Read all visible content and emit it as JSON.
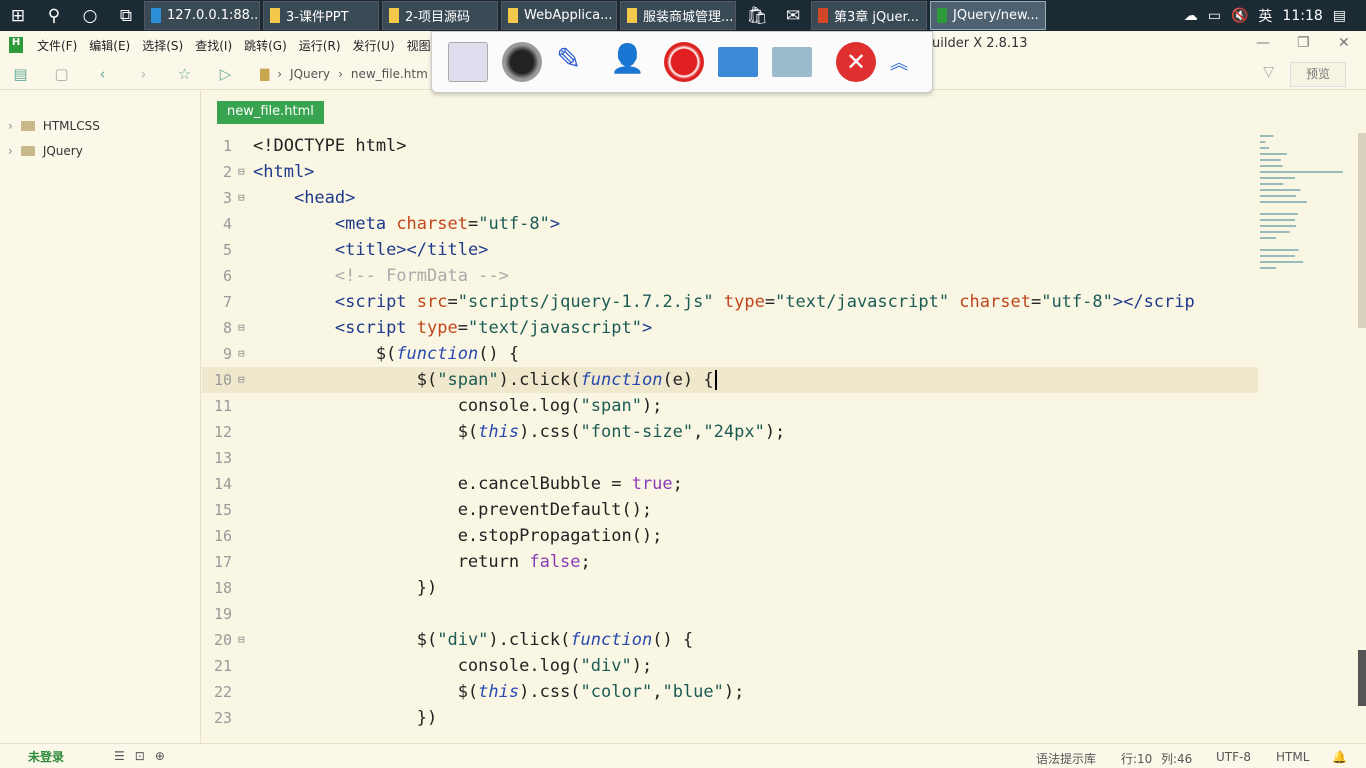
{
  "taskbar": {
    "apps": [
      {
        "label": "127.0.0.1:88...",
        "icon": "edge-icon"
      },
      {
        "label": "3-课件PPT",
        "icon": "folder-icon"
      },
      {
        "label": "2-项目源码",
        "icon": "folder-icon"
      },
      {
        "label": "WebApplica...",
        "icon": "folder-icon"
      },
      {
        "label": "服装商城管理...",
        "icon": "folder-icon"
      }
    ],
    "apps2": [
      {
        "label": "第3章 jQuer...",
        "icon": "powerpoint-icon"
      },
      {
        "label": "JQuery/new...",
        "icon": "hbuilder-icon"
      }
    ],
    "ime": "英",
    "time": "11:18"
  },
  "menu": [
    "文件(F)",
    "编辑(E)",
    "选择(S)",
    "查找(I)",
    "跳转(G)",
    "运行(R)",
    "发行(U)",
    "视图"
  ],
  "window_title": "uilder X 2.8.13",
  "breadcrumb": [
    "JQuery",
    "new_file.htm"
  ],
  "preview": "预览",
  "sidebar": [
    {
      "label": "HTMLCSS"
    },
    {
      "label": "JQuery"
    }
  ],
  "tab": "new_file.html",
  "current_line": 10,
  "code": [
    [
      [
        "<!DOCTYPE html>",
        "pl"
      ]
    ],
    [
      [
        "<html>",
        "tag"
      ]
    ],
    [
      [
        "    "
      ],
      [
        "<head>",
        "tag"
      ]
    ],
    [
      [
        "        "
      ],
      [
        "<meta ",
        "tag"
      ],
      [
        "charset",
        "attr"
      ],
      [
        "=",
        "pl"
      ],
      [
        "\"utf-8\"",
        "str"
      ],
      [
        ">",
        "tag"
      ]
    ],
    [
      [
        "        "
      ],
      [
        "<title></title>",
        "tag"
      ]
    ],
    [
      [
        "        "
      ],
      [
        "<!-- FormData -->",
        "com"
      ]
    ],
    [
      [
        "        "
      ],
      [
        "<script ",
        "tag"
      ],
      [
        "src",
        "attr"
      ],
      [
        "=",
        "pl"
      ],
      [
        "\"scripts/jquery-1.7.2.js\"",
        "str"
      ],
      [
        " type",
        "attr"
      ],
      [
        "=",
        "pl"
      ],
      [
        "\"text/javascript\"",
        "str"
      ],
      [
        " charset",
        "attr"
      ],
      [
        "=",
        "pl"
      ],
      [
        "\"utf-8\"",
        "str"
      ],
      [
        "></scrip",
        "tag"
      ]
    ],
    [
      [
        "        "
      ],
      [
        "<script ",
        "tag"
      ],
      [
        "type",
        "attr"
      ],
      [
        "=",
        "pl"
      ],
      [
        "\"text/javascript\"",
        "str"
      ],
      [
        ">",
        "tag"
      ]
    ],
    [
      [
        "            $(",
        "pl"
      ],
      [
        "function",
        "kw"
      ],
      [
        "() {",
        "pl"
      ]
    ],
    [
      [
        "                $(",
        "pl"
      ],
      [
        "\"span\"",
        "str"
      ],
      [
        ").click(",
        "pl"
      ],
      [
        "function",
        "kw"
      ],
      [
        "(e) {",
        "pl"
      ]
    ],
    [
      [
        "                    console.log(",
        "pl"
      ],
      [
        "\"span\"",
        "str"
      ],
      [
        ");",
        "pl"
      ]
    ],
    [
      [
        "                    $(",
        "pl"
      ],
      [
        "this",
        "kw"
      ],
      [
        ").css(",
        "pl"
      ],
      [
        "\"font-size\"",
        "str"
      ],
      [
        ",",
        "pl"
      ],
      [
        "\"24px\"",
        "str"
      ],
      [
        ");",
        "pl"
      ]
    ],
    [],
    [
      [
        "                    e.cancelBubble = ",
        "pl"
      ],
      [
        "true",
        "bool"
      ],
      [
        ";",
        "pl"
      ]
    ],
    [
      [
        "                    e.preventDefault();",
        "pl"
      ]
    ],
    [
      [
        "                    e.stopPropagation();",
        "pl"
      ]
    ],
    [
      [
        "                    return ",
        "pl"
      ],
      [
        "false",
        "bool"
      ],
      [
        ";",
        "pl"
      ]
    ],
    [
      [
        "                })",
        "pl"
      ]
    ],
    [],
    [
      [
        "                $(",
        "pl"
      ],
      [
        "\"div\"",
        "str"
      ],
      [
        ").click(",
        "pl"
      ],
      [
        "function",
        "kw"
      ],
      [
        "() {",
        "pl"
      ]
    ],
    [
      [
        "                    console.log(",
        "pl"
      ],
      [
        "\"div\"",
        "str"
      ],
      [
        ");",
        "pl"
      ]
    ],
    [
      [
        "                    $(",
        "pl"
      ],
      [
        "this",
        "kw"
      ],
      [
        ").css(",
        "pl"
      ],
      [
        "\"color\"",
        "str"
      ],
      [
        ",",
        "pl"
      ],
      [
        "\"blue\"",
        "str"
      ],
      [
        ");",
        "pl"
      ]
    ],
    [
      [
        "                })",
        "pl"
      ]
    ]
  ],
  "foldable": [
    2,
    3,
    8,
    9,
    10,
    20
  ],
  "status": {
    "login": "未登录",
    "syntax": "语法提示库",
    "line": "行:10",
    "col": "列:46",
    "encoding": "UTF-8",
    "lang": "HTML"
  }
}
